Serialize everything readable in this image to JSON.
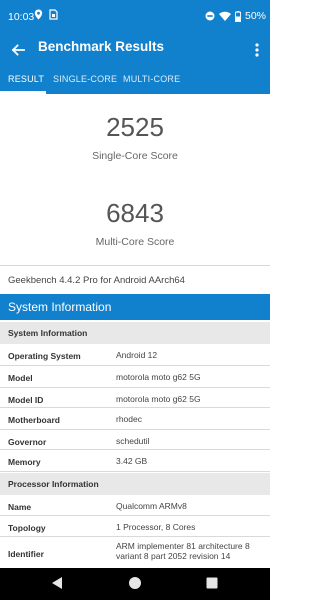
{
  "status": {
    "time": "10:03",
    "battery": "50%"
  },
  "appbar": {
    "title": "Benchmark Results"
  },
  "tabs": [
    {
      "label": "RESULT",
      "active": true
    },
    {
      "label": "SINGLE-CORE",
      "active": false
    },
    {
      "label": "MULTI-CORE",
      "active": false
    }
  ],
  "scores": {
    "single_value": "2525",
    "single_label": "Single-Core Score",
    "multi_value": "6843",
    "multi_label": "Multi-Core Score"
  },
  "version": "Geekbench 4.4.2 Pro for Android AArch64",
  "system_information_title": "System Information",
  "sections": {
    "system": {
      "title": "System Information",
      "rows": [
        {
          "key": "Operating System",
          "value": "Android 12"
        },
        {
          "key": "Model",
          "value": "motorola moto g62 5G"
        },
        {
          "key": "Model ID",
          "value": "motorola moto g62 5G"
        },
        {
          "key": "Motherboard",
          "value": "rhodec"
        },
        {
          "key": "Governor",
          "value": "schedutil"
        },
        {
          "key": "Memory",
          "value": "3.42 GB"
        }
      ]
    },
    "processor": {
      "title": "Processor Information",
      "rows": [
        {
          "key": "Name",
          "value": "Qualcomm ARMv8"
        },
        {
          "key": "Topology",
          "value": "1 Processor, 8 Cores"
        },
        {
          "key": "Identifier",
          "value": "ARM implementer 81 architecture 8 variant 8 part 2052 revision 14"
        }
      ]
    }
  },
  "colors": {
    "accent": "#1181cd",
    "section_bg": "#e8e8e8"
  },
  "icons": [
    "location-icon",
    "sim-icon",
    "do-not-disturb-icon",
    "wifi-icon",
    "battery-icon",
    "back-arrow-icon",
    "more-vert-icon",
    "nav-back-icon",
    "nav-home-icon",
    "nav-recents-icon"
  ]
}
